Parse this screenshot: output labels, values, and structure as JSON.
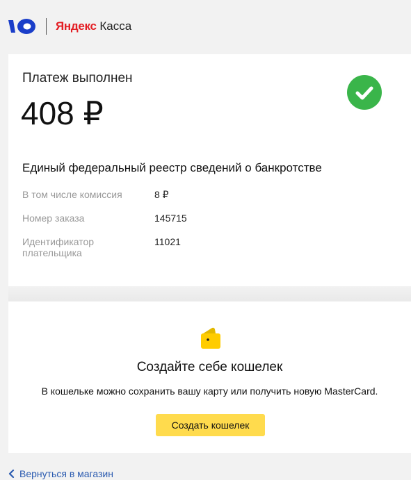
{
  "header": {
    "brand_part1": "Яндекс",
    "brand_part2": "Касса",
    "logo_icon": "yookassa-logo-icon"
  },
  "payment": {
    "status": "Платеж выполнен",
    "amount": "408 ₽",
    "status_icon": "check-circle-icon",
    "merchant": "Единый федеральный реестр сведений о банкротстве",
    "details": [
      {
        "label": "В том числе комиссия",
        "value": "8 ₽"
      },
      {
        "label": "Номер заказа",
        "value": "145715"
      },
      {
        "label": "Идентификатор плательщика",
        "value": "11021"
      }
    ]
  },
  "wallet": {
    "icon": "wallet-icon",
    "title": "Создайте себе кошелек",
    "text": "В кошельке можно сохранить вашу карту или получить новую MasterCard.",
    "button_label": "Создать кошелек"
  },
  "footer": {
    "back_label": "Вернуться в магазин",
    "back_icon": "chevron-left-icon"
  },
  "colors": {
    "background": "#f2f2f2",
    "success_green": "#3ab54a",
    "brand_red": "#e31e24",
    "button_yellow": "#ffdb4d",
    "link_blue": "#2b5bb0",
    "label_gray": "#999999",
    "logo_blue": "#1a3ec9"
  }
}
